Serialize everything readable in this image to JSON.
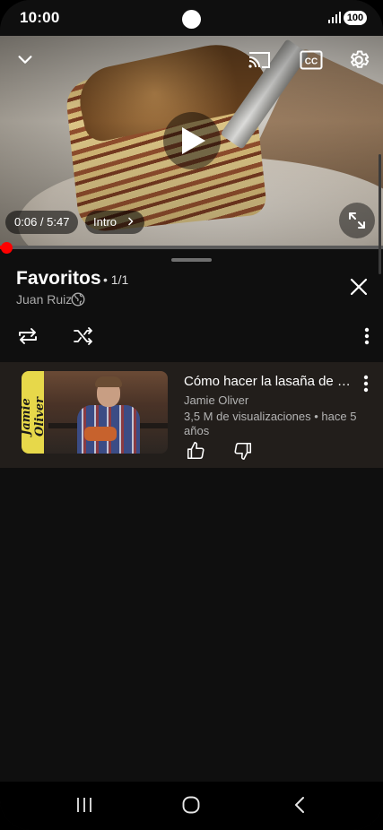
{
  "status_bar": {
    "time": "10:00",
    "battery": "100"
  },
  "player": {
    "elapsed": "0:06",
    "separator": " / ",
    "duration": "5:47",
    "chapter": "Intro",
    "progress_fraction": 0.017,
    "icons": [
      "chevron-down-icon",
      "cast-icon",
      "captions-icon",
      "gear-icon",
      "play-icon",
      "fullscreen-icon"
    ]
  },
  "playlist": {
    "title": "Favoritos",
    "position": "• 1/1",
    "owner": "Juan Ruiz",
    "items": [
      {
        "thumbnail_text": "Jamie Oliver",
        "title": "Cómo hacer la lasaña de …",
        "channel": "Jamie Oliver",
        "meta": "3,5 M de visualizaciones • hace 5 años"
      }
    ]
  },
  "colors": {
    "accent": "#ff0000",
    "background": "#0f0f0f",
    "item_background": "#221e1b"
  }
}
